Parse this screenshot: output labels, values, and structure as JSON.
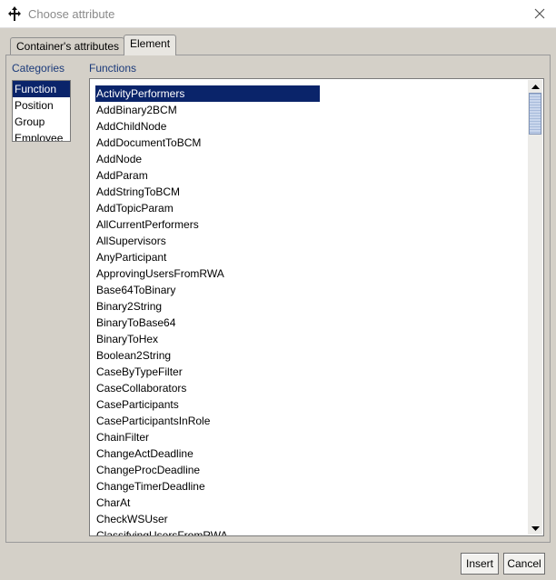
{
  "window": {
    "title": "Choose attribute",
    "title_icon": "drag-move-icon",
    "close_icon": "close-icon"
  },
  "tabs": [
    {
      "label": "Container's attributes",
      "selected": false
    },
    {
      "label": "Element",
      "selected": true
    }
  ],
  "categories": {
    "label": "Categories",
    "items": [
      "Function",
      "Position",
      "Group",
      "Employee"
    ],
    "selected": "Function"
  },
  "functions": {
    "label": "Functions",
    "items": [
      "ActivityPerformers",
      "AddBinary2BCM",
      "AddChildNode",
      "AddDocumentToBCM",
      "AddNode",
      "AddParam",
      "AddStringToBCM",
      "AddTopicParam",
      "AllCurrentPerformers",
      "AllSupervisors",
      "AnyParticipant",
      "ApprovingUsersFromRWA",
      "Base64ToBinary",
      "Binary2String",
      "BinaryToBase64",
      "BinaryToHex",
      "Boolean2String",
      "CaseByTypeFilter",
      "CaseCollaborators",
      "CaseParticipants",
      "CaseParticipantsInRole",
      "ChainFilter",
      "ChangeActDeadline",
      "ChangeProcDeadline",
      "ChangeTimerDeadline",
      "CharAt",
      "CheckWSUser",
      "ClassifyingUsersFromRWA"
    ],
    "selected": "ActivityPerformers"
  },
  "buttons": {
    "insert": "Insert",
    "cancel": "Cancel"
  },
  "colors": {
    "selection": "#0a246a",
    "dialog_bg": "#d4d0c8",
    "label_text": "#1b3a7a"
  }
}
